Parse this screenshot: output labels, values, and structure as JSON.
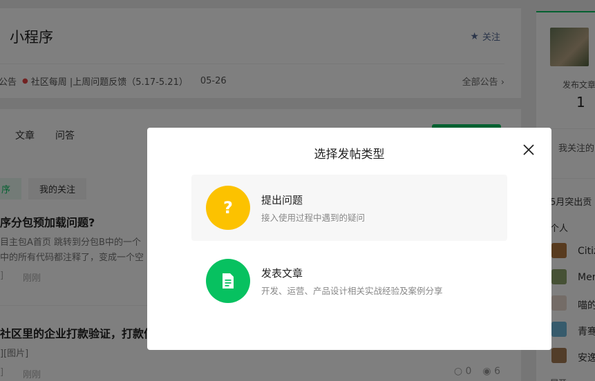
{
  "header": {
    "title": "小程序",
    "follow_label": "关注",
    "announcement_label": "公告",
    "announcement_text": "社区每周 |上周问题反馈（5.17-5.21）",
    "announcement_date": "05-26",
    "all_announcements": "全部公告"
  },
  "feed": {
    "tabs": [
      "文章",
      "问答"
    ],
    "chips": [
      "序",
      "我的关注"
    ],
    "posts": [
      {
        "title": "序分包预加载问题?",
        "line1": "目主包A首页 跳转到分包B中的一个",
        "line2": "中的所有代码都注释了，变成一个空",
        "tag": "]",
        "time": "刚刚"
      },
      {
        "title": "社区里的企业打款验证，打款信",
        "line1": "][图片]",
        "tag": "]",
        "time": "刚刚",
        "comments": "0",
        "views": "6"
      }
    ]
  },
  "sidebar": {
    "stat_label": "发布文章",
    "stat_value": "1",
    "following_label": "我关注的",
    "burst_label": "5月突出贡",
    "people_label": "个人",
    "names": [
      "Citiz",
      "Mer",
      "喵的",
      "青骞",
      "安逸"
    ],
    "more_label": "展开"
  },
  "modal": {
    "title": "选择发帖类型",
    "options": [
      {
        "icon": "question-mark-icon",
        "symbol": "?",
        "name": "提出问题",
        "desc": "接入使用过程中遇到的疑问"
      },
      {
        "icon": "document-icon",
        "name": "发表文章",
        "desc": "开发、运营、产品设计相关实战经验及案例分享"
      }
    ]
  },
  "colors": {
    "brand_green": "#07c160",
    "question_yellow": "#fcc200",
    "link_blue": "#576b95",
    "overlay": "rgba(0,0,0,0.5)"
  }
}
